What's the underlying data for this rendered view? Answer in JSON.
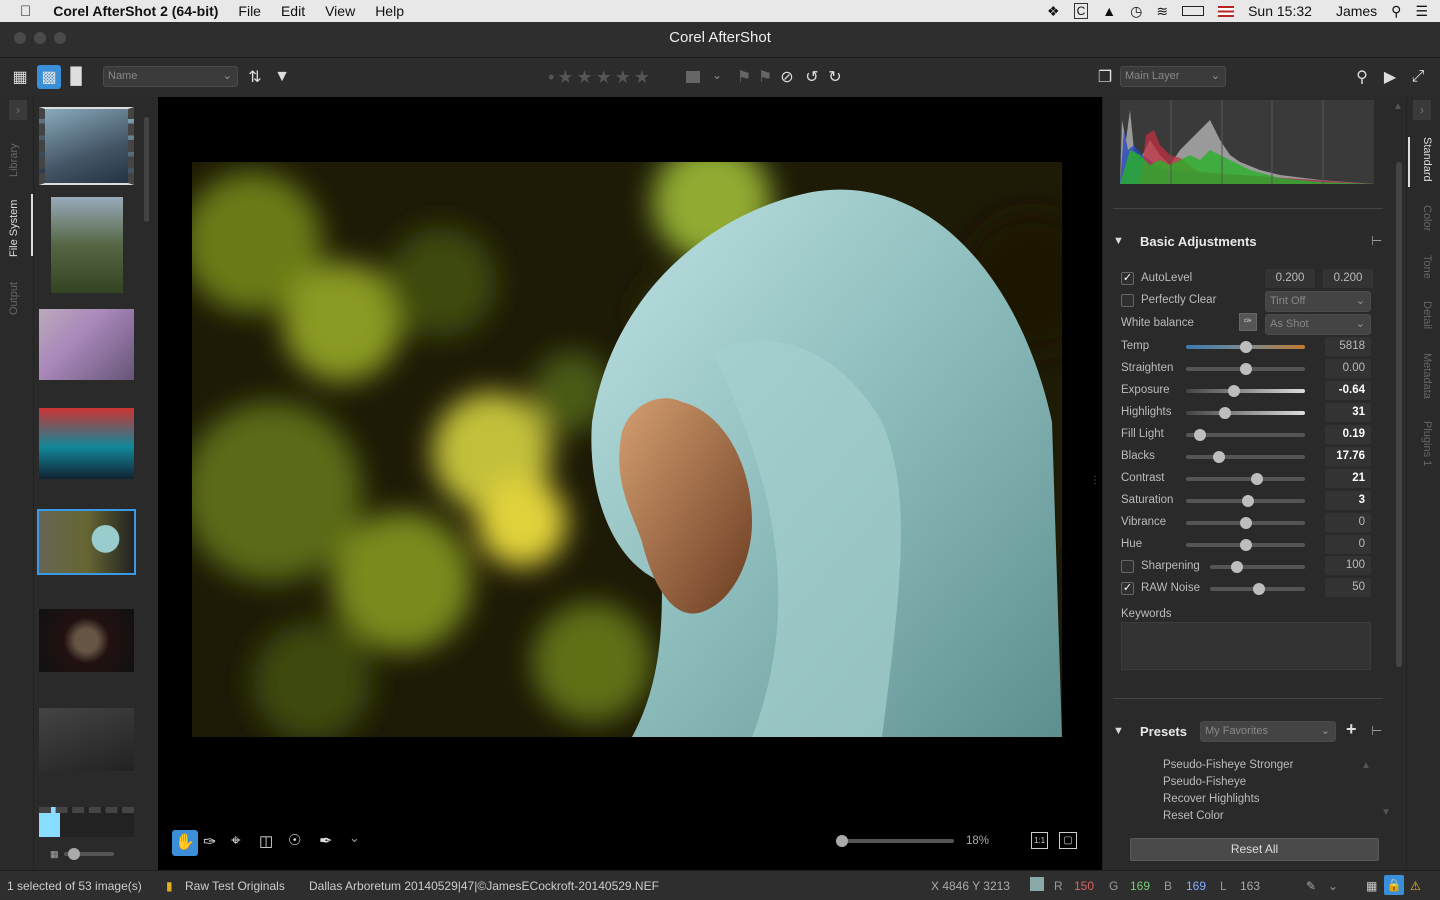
{
  "menubar": {
    "app_name": "Corel AfterShot 2 (64-bit)",
    "menus": [
      "File",
      "Edit",
      "View",
      "Help"
    ],
    "clock": "Sun 15:32",
    "user": "James"
  },
  "window": {
    "title": "Corel AfterShot"
  },
  "toolbar": {
    "sort_select": "Name",
    "layer_select": "Main Layer"
  },
  "left_tabs": [
    "Library",
    "File System",
    "Output"
  ],
  "right_tabs": [
    "Standard",
    "Color",
    "Tone",
    "Detail",
    "Metadata",
    "Plugins 1"
  ],
  "viewer": {
    "zoom": "18%"
  },
  "adjustments": {
    "title": "Basic Adjustments",
    "autolevel": {
      "label": "AutoLevel",
      "checked": true,
      "v1": "0.200",
      "v2": "0.200"
    },
    "perfectly_clear": {
      "label": "Perfectly Clear",
      "checked": false,
      "option": "Tint Off"
    },
    "white_balance": {
      "label": "White balance",
      "option": "As Shot"
    },
    "sliders": [
      {
        "label": "Temp",
        "value": "5818",
        "pos": 0.5
      },
      {
        "label": "Straighten",
        "value": "0.00",
        "pos": 0.5
      },
      {
        "label": "Exposure",
        "value": "-0.64",
        "pos": 0.4
      },
      {
        "label": "Highlights",
        "value": "31",
        "pos": 0.33
      },
      {
        "label": "Fill Light",
        "value": "0.19",
        "pos": 0.12
      },
      {
        "label": "Blacks",
        "value": "17.76",
        "pos": 0.28
      },
      {
        "label": "Contrast",
        "value": "21",
        "pos": 0.6
      },
      {
        "label": "Saturation",
        "value": "3",
        "pos": 0.52
      },
      {
        "label": "Vibrance",
        "value": "0",
        "pos": 0.5
      },
      {
        "label": "Hue",
        "value": "0",
        "pos": 0.5
      }
    ],
    "sharpening": {
      "label": "Sharpening",
      "checked": false,
      "value": "100",
      "pos": 0.28
    },
    "raw_noise": {
      "label": "RAW Noise",
      "checked": true,
      "value": "50",
      "pos": 0.52
    },
    "keywords_label": "Keywords"
  },
  "presets": {
    "title": "Presets",
    "select": "My Favorites",
    "items": [
      "Pseudo-Fisheye Stronger",
      "Pseudo-Fisheye",
      "Recover Highlights",
      "Reset Color"
    ],
    "reset_all": "Reset All"
  },
  "status": {
    "selection": "1 selected of 53 image(s)",
    "folder": "Raw Test Originals",
    "file": "Dallas Arboretum 20140529|47|©JamesECockroft-20140529.NEF",
    "coords": "X 4846  Y 3213",
    "r_label": "R",
    "r": "150",
    "g_label": "G",
    "g": "169",
    "b_label": "B",
    "b": "169",
    "l_label": "L",
    "l": "163"
  }
}
